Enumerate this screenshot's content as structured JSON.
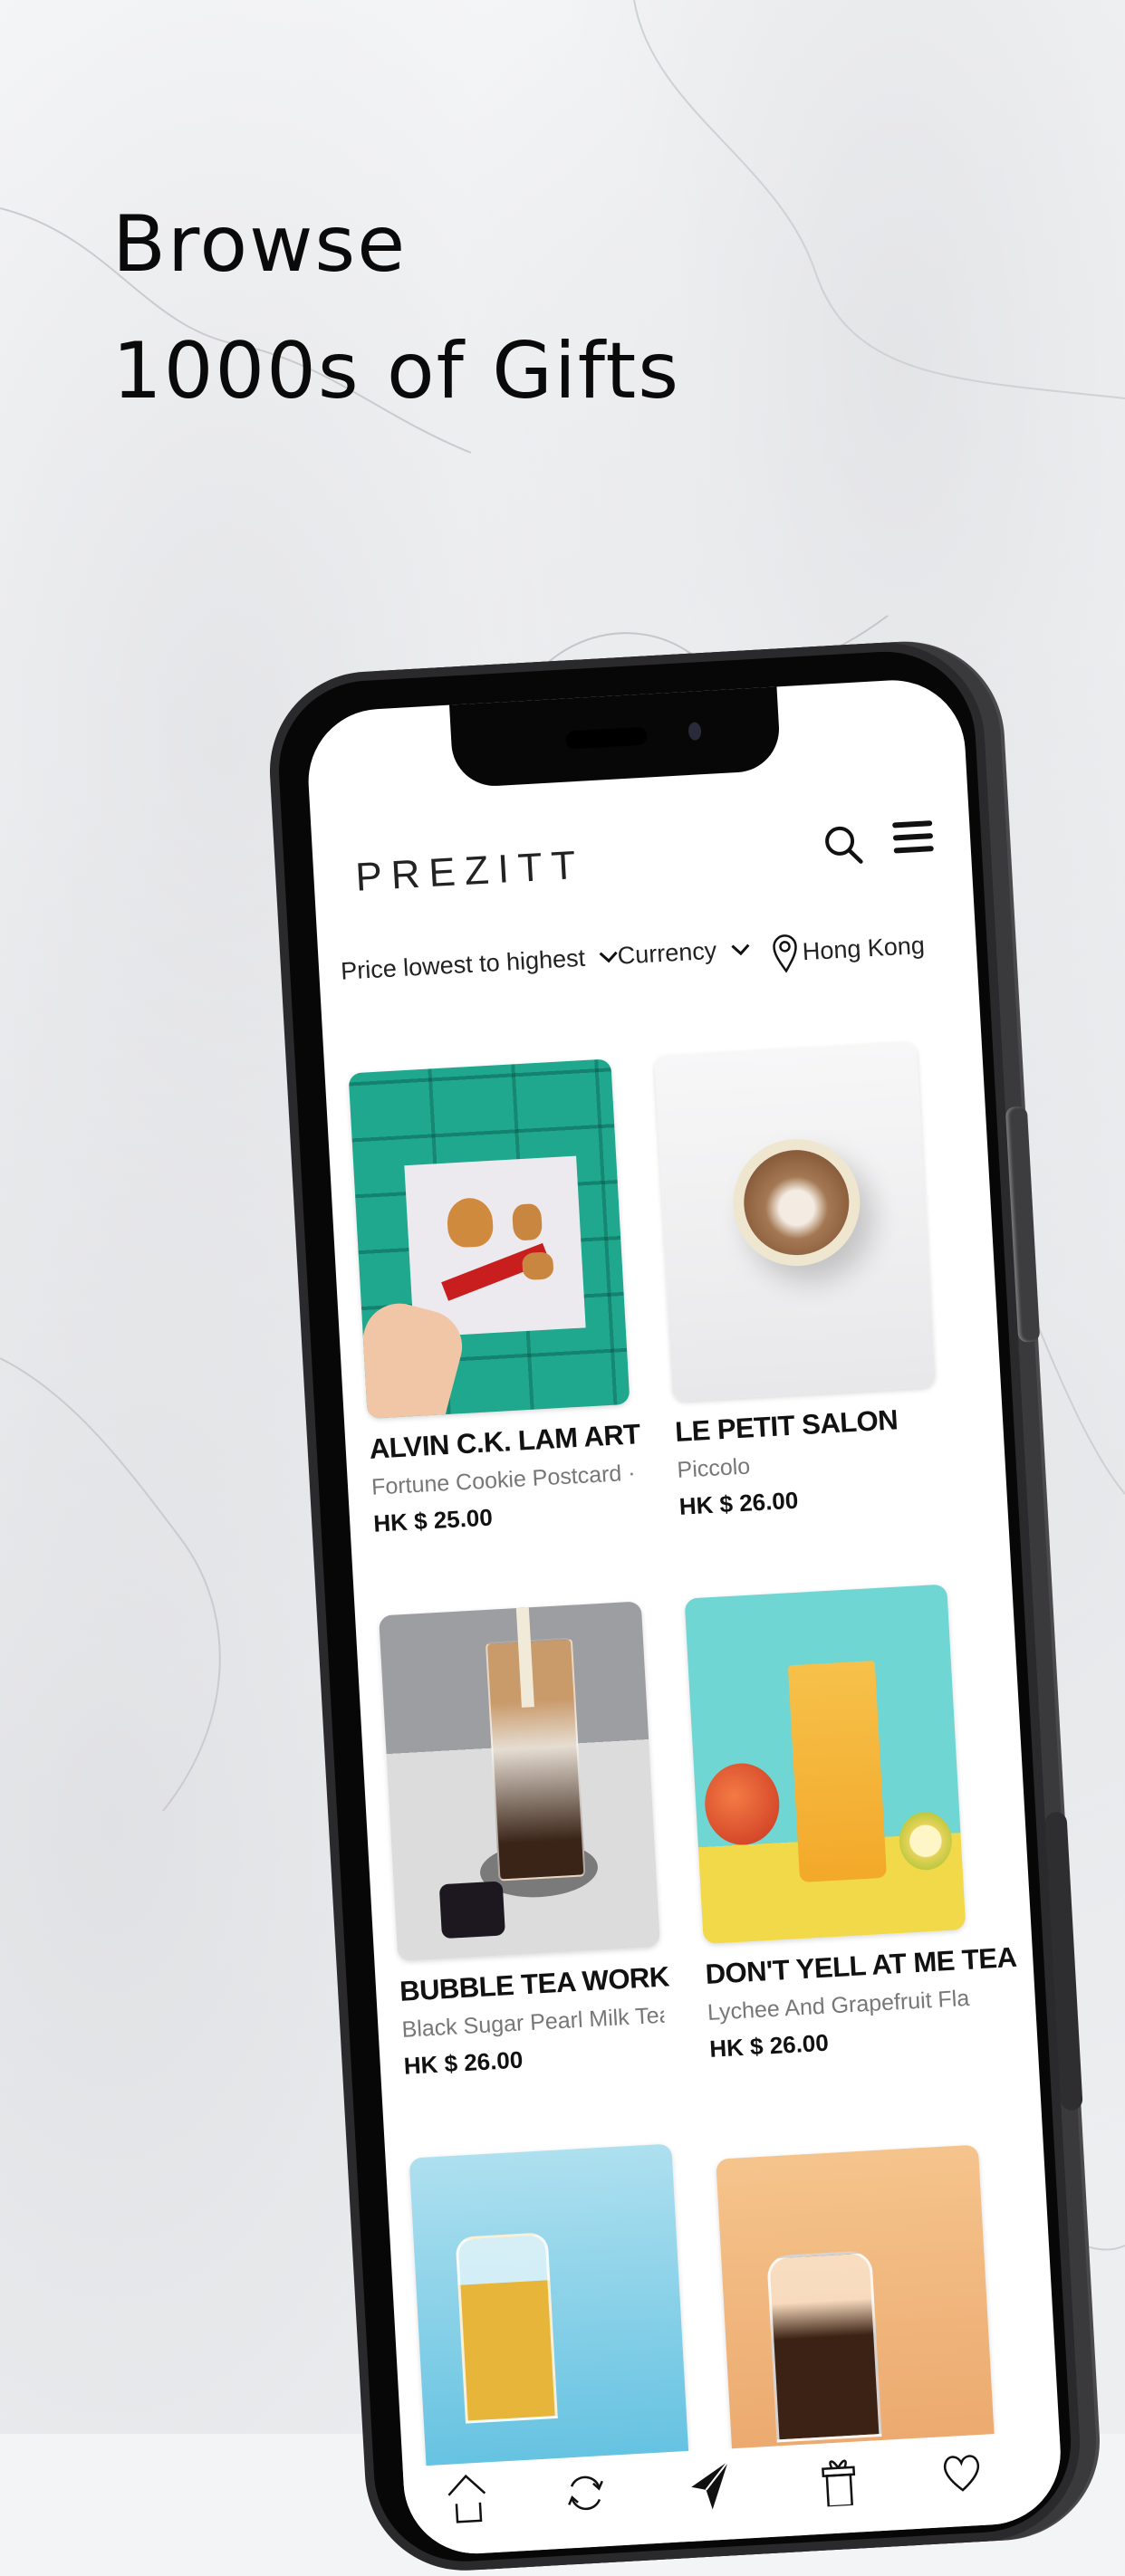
{
  "headline": {
    "line1": "Browse",
    "line2": "1000s of Gifts"
  },
  "app": {
    "logo": "PREZITT",
    "header_icons": [
      "search-icon",
      "menu-icon"
    ]
  },
  "filters": {
    "sort": {
      "label": "Price lowest to highest",
      "icon": "chevron-down-icon"
    },
    "currency": {
      "label": "Currency",
      "icon": "chevron-down-icon"
    },
    "location": {
      "label": "Hong Kong",
      "icon": "location-pin-icon"
    }
  },
  "products": [
    {
      "brand": "ALVIN C.K. LAM ART",
      "name": "Fortune Cookie Postcard · HK",
      "price": "HK $ 25.00",
      "image": "fortune-cookie-postcard-on-teal-wall"
    },
    {
      "brand": "LE PETIT SALON",
      "name": "Piccolo",
      "price": "HK $ 26.00",
      "image": "latte-art-cup-top-view"
    },
    {
      "brand": "BUBBLE TEA WORK",
      "name": "Black Sugar Pearl Milk Tea",
      "price": "HK $ 26.00",
      "image": "brown-sugar-milk-tea-glass"
    },
    {
      "brand": "DON'T YELL AT ME TEA",
      "name": "Lychee And Grapefruit Flavored",
      "price": "HK $ 26.00",
      "image": "fruit-tea-with-apple-and-lemon"
    },
    {
      "brand": "",
      "name": "",
      "price": "",
      "image": "tea-jug-on-blue"
    },
    {
      "brand": "",
      "name": "",
      "price": "",
      "image": "tea-jug-on-orange"
    }
  ],
  "tabbar": [
    {
      "icon": "home-icon"
    },
    {
      "icon": "refresh-icon"
    },
    {
      "icon": "send-icon",
      "active": true
    },
    {
      "icon": "gift-icon"
    },
    {
      "icon": "heart-icon"
    }
  ],
  "colors": {
    "background": "#f3f4f5",
    "phone_frame": "#2a2a2c",
    "text_primary": "#111111",
    "text_secondary": "#777777"
  }
}
